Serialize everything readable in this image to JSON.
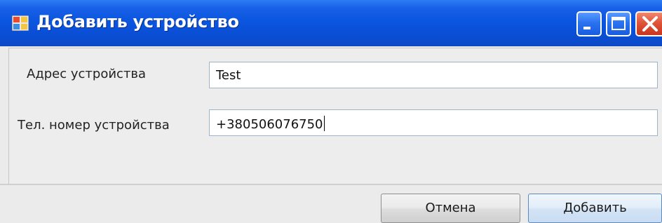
{
  "window": {
    "title": "Добавить устройство",
    "icon": "app-form-icon",
    "controls": [
      "minimize-icon",
      "maximize-icon",
      "close-icon"
    ]
  },
  "form": {
    "address_label": "Адрес устройства",
    "address_value": "Test",
    "phone_label": "Тел. номер устройства",
    "phone_value": "+380506076750"
  },
  "buttons": {
    "cancel_label": "Отмена",
    "add_label": "Добавить"
  },
  "colors": {
    "titlebar": "#0b56e0",
    "close": "#e0543a",
    "default_button_border": "#5a8ac0"
  }
}
